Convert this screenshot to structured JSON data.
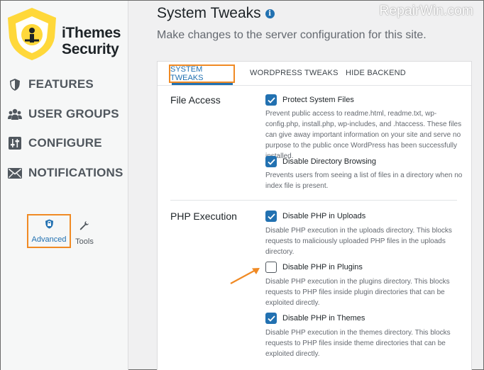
{
  "sidebar": {
    "logo_lines": [
      "iThemes",
      "Security"
    ],
    "items": [
      {
        "label": "FEATURES",
        "icon": "shield-icon"
      },
      {
        "label": "USER GROUPS",
        "icon": "users-icon"
      },
      {
        "label": "CONFIGURE",
        "icon": "sliders-icon"
      },
      {
        "label": "NOTIFICATIONS",
        "icon": "envelope-icon"
      }
    ],
    "sub": {
      "advanced": {
        "label": "Advanced",
        "icon": "lock-shield-icon"
      },
      "tools": {
        "label": "Tools",
        "icon": "wrench-icon"
      }
    }
  },
  "header": {
    "title": "System Tweaks",
    "subtitle": "Make changes to the server configuration for this site.",
    "watermark": "RepairWin.com"
  },
  "tabs": [
    {
      "label": "SYSTEM TWEAKS",
      "active": true
    },
    {
      "label": "WORDPRESS TWEAKS",
      "active": false
    },
    {
      "label": "HIDE BACKEND",
      "active": false
    }
  ],
  "sections": {
    "file_access": {
      "label": "File Access",
      "options": [
        {
          "label": "Protect System Files",
          "checked": true,
          "desc": "Prevent public access to readme.html, readme.txt, wp-config.php, install.php, wp-includes, and .htaccess. These files can give away important information on your site and serve no purpose to the public once WordPress has been successfully installed."
        },
        {
          "label": "Disable Directory Browsing",
          "checked": true,
          "desc": "Prevents users from seeing a list of files in a directory when no index file is present."
        }
      ]
    },
    "php_execution": {
      "label": "PHP Execution",
      "options": [
        {
          "label": "Disable PHP in Uploads",
          "checked": true,
          "desc": "Disable PHP execution in the uploads directory. This blocks requests to maliciously uploaded PHP files in the uploads directory."
        },
        {
          "label": "Disable PHP in Plugins",
          "checked": false,
          "desc": "Disable PHP execution in the plugins directory. This blocks requests to PHP files inside plugin directories that can be exploited directly."
        },
        {
          "label": "Disable PHP in Themes",
          "checked": true,
          "desc": "Disable PHP execution in the themes directory. This blocks requests to PHP files inside theme directories that can be exploited directly."
        }
      ]
    }
  },
  "colors": {
    "accent": "#2271b1",
    "highlight": "#f08a24",
    "logo_yellow": "#ffd83a"
  }
}
